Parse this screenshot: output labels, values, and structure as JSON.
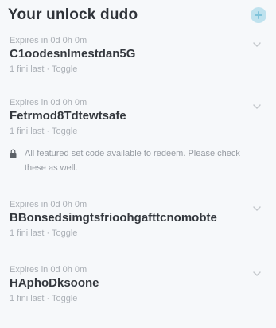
{
  "header": {
    "title": "Your unlock dudo",
    "icon": "add-icon"
  },
  "items": [
    {
      "label": "Expires in 0d 0h 0m",
      "value": "C1oodesnlmestdan5G",
      "sub": "1 fini last · Toggle"
    },
    {
      "label": "Expires in 0d 0h 0m",
      "value": "Fetrmod8Tdtewtsafe",
      "sub": "1 fini last · Toggle",
      "notice": "All featured set code available to redeem. Please check these as well."
    },
    {
      "label": "Expires in 0d 0h 0m",
      "value": "BBonsedsimgtsfrioohgafttcnomobte",
      "sub": "1 fini last · Toggle"
    },
    {
      "label": "Expires in 0d 0h 0m",
      "value": "HAphoDksoone",
      "sub": "1 fini last · Toggle"
    }
  ],
  "colors": {
    "background": "#f6f8fa",
    "accent": "#bfe2ee"
  }
}
